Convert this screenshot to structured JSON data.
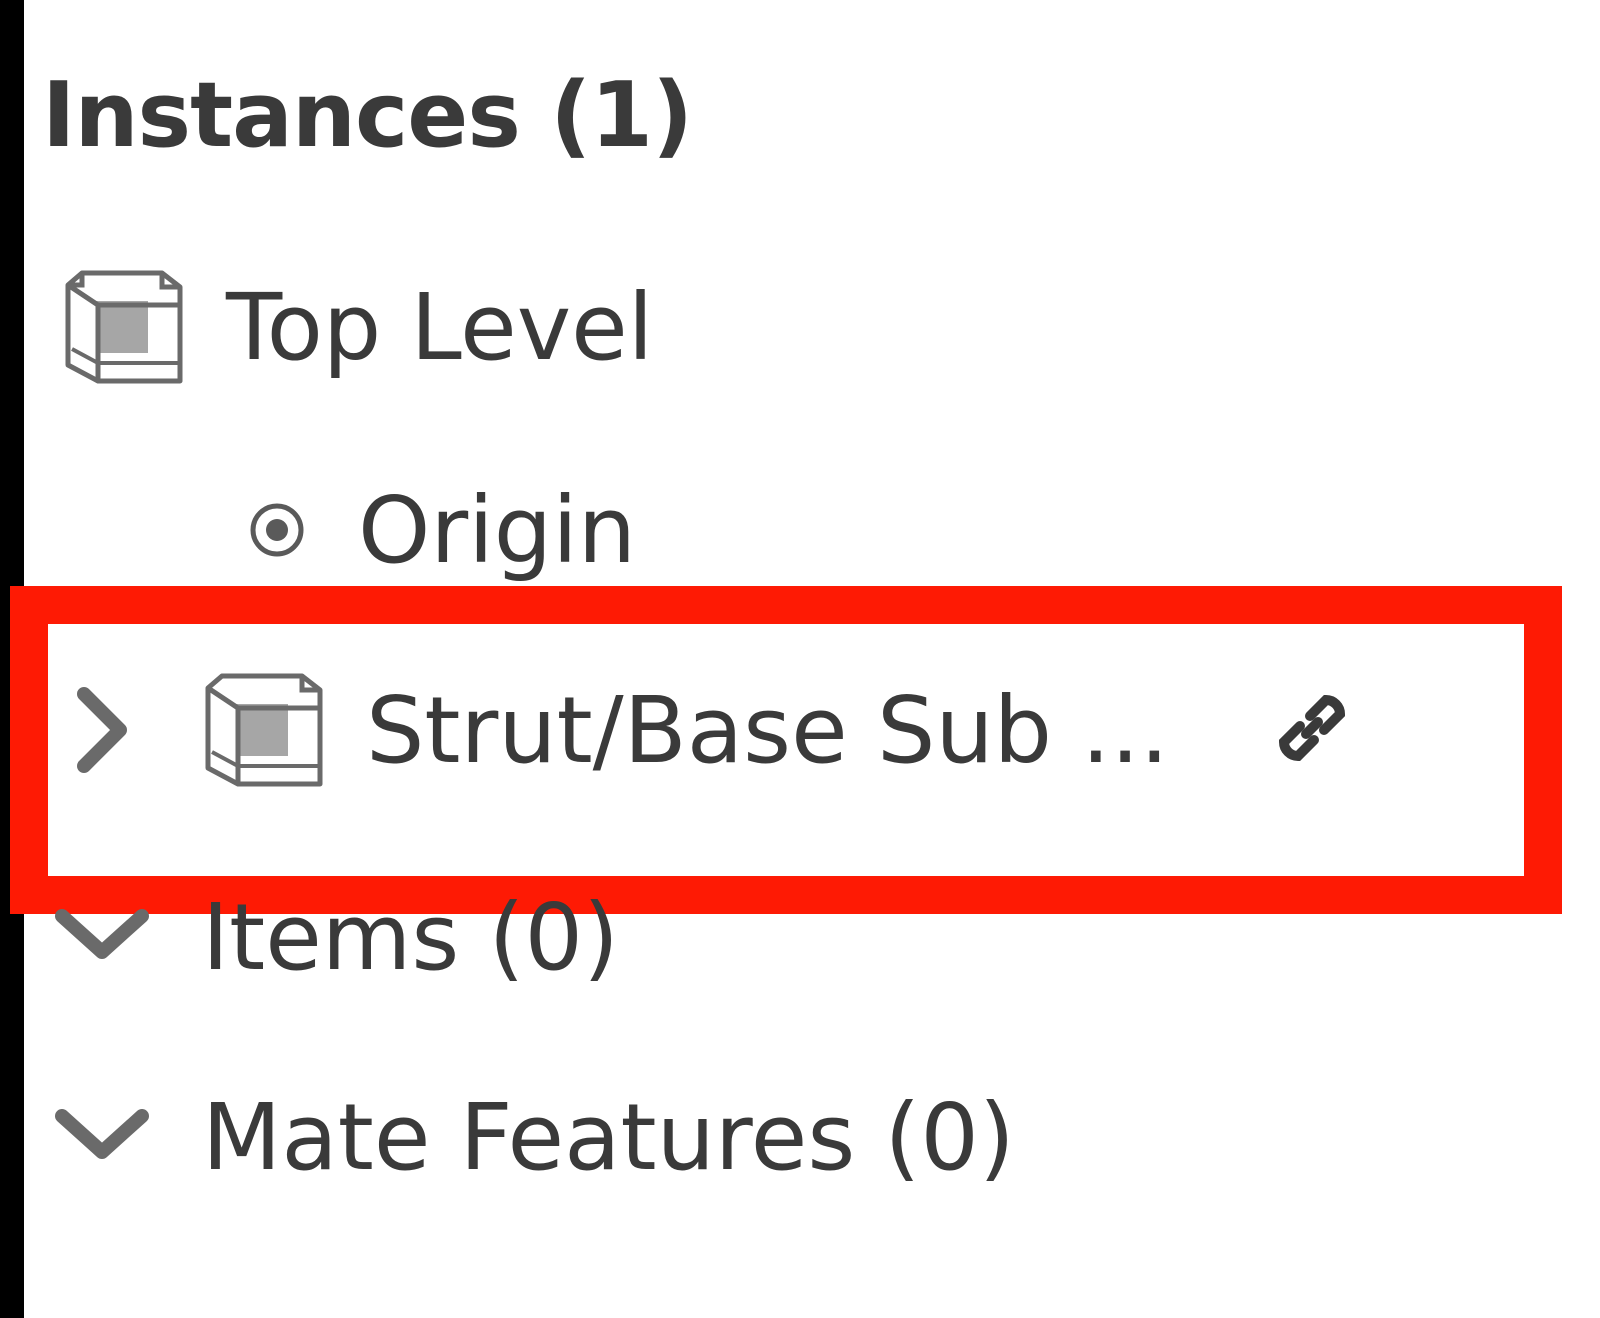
{
  "panel": {
    "header": "Instances (1)"
  },
  "tree": {
    "top_level": {
      "label": "Top Level",
      "icon": "part-cube-icon"
    },
    "origin": {
      "label": "Origin",
      "icon": "origin-icon"
    },
    "instance": {
      "label": "Strut/Base Sub ...",
      "icon": "part-cube-icon",
      "expand_icon": "chevron-right-icon",
      "linked_icon": "link-icon"
    },
    "items": {
      "label": "Items (0)",
      "icon": "chevron-down-icon"
    },
    "mate_features": {
      "label": "Mate Features (0)",
      "icon": "chevron-down-icon"
    }
  },
  "colors": {
    "highlight": "#fe1a04",
    "text": "#3a3a3a",
    "icon_gray": "#6a6a6a",
    "cube_fill": "#a6a6a6"
  }
}
